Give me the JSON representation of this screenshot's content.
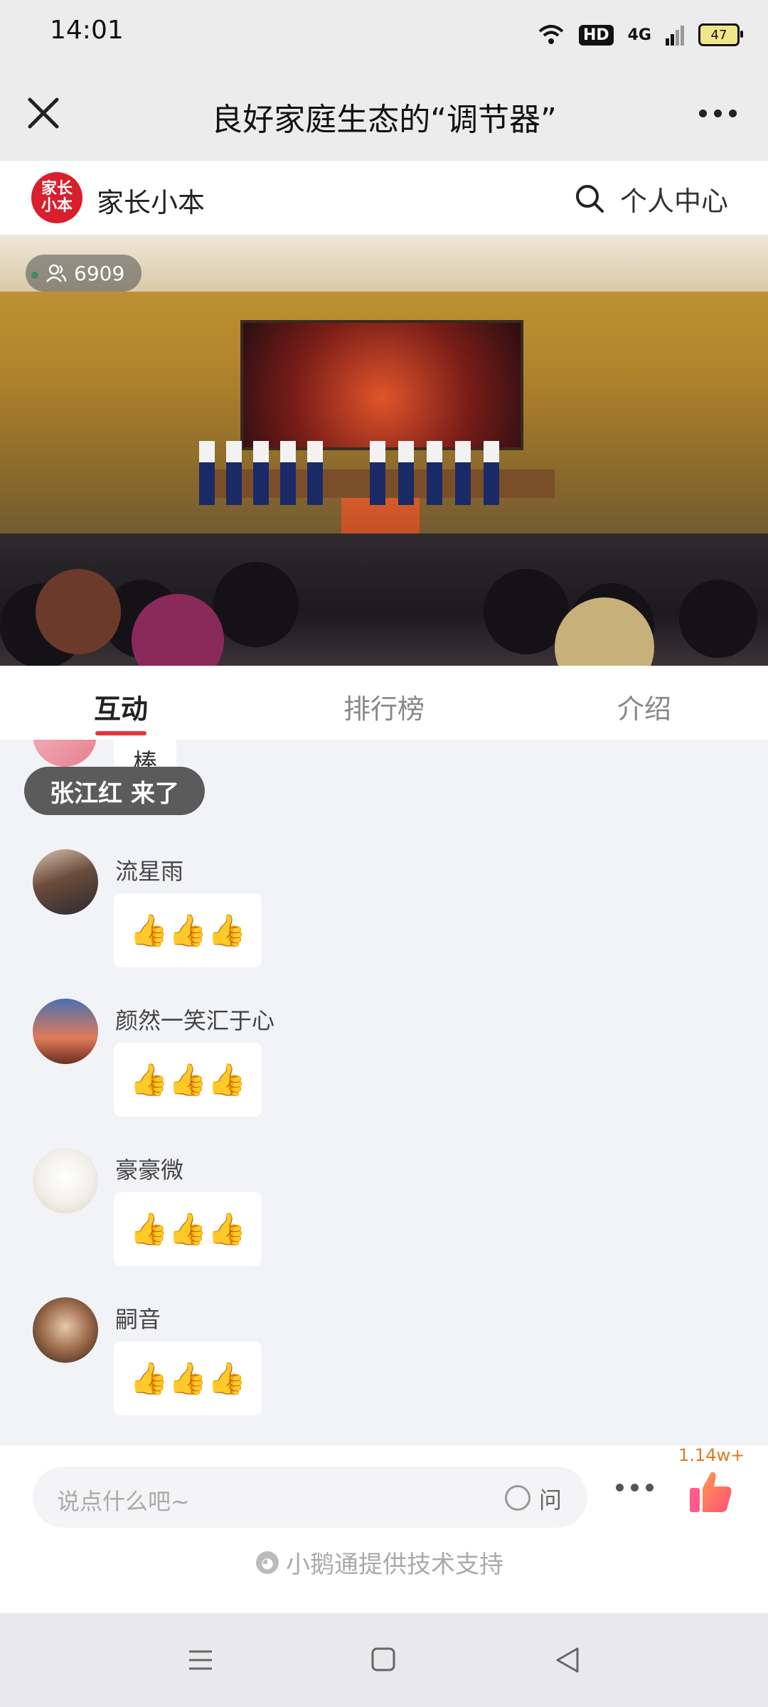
{
  "status_bar": {
    "time": "14:01",
    "hd_label": "HD",
    "network_label": "4G",
    "battery": "47"
  },
  "title_bar": {
    "title": "良好家庭生态的“调节器”",
    "close_icon": "close-icon",
    "more_icon": "more-icon"
  },
  "channel": {
    "logo_text": "家长小本",
    "name": "家长小本",
    "personal_center": "个人中心"
  },
  "video": {
    "viewer_count": "6909"
  },
  "tabs": [
    {
      "label": "互动",
      "active": true
    },
    {
      "label": "排行榜",
      "active": false
    },
    {
      "label": "介绍",
      "active": false
    }
  ],
  "chat": {
    "partial_bubble": "棒",
    "join_toast": "张江红 来了",
    "messages": [
      {
        "name": "流星雨",
        "text": "👍👍👍"
      },
      {
        "name": "颜然一笑汇于心",
        "text": "👍👍👍"
      },
      {
        "name": "豪豪微",
        "text": "👍👍👍"
      },
      {
        "name": "嗣音",
        "text": "👍👍👍"
      }
    ]
  },
  "input_bar": {
    "placeholder": "说点什么吧~",
    "ask_label": "问",
    "like_count": "1.14w+",
    "powered_by": "小鹅通提供技术支持"
  },
  "colors": {
    "accent": "#e8333b",
    "logo": "#d81f2b",
    "like_count": "#e07a1c"
  }
}
